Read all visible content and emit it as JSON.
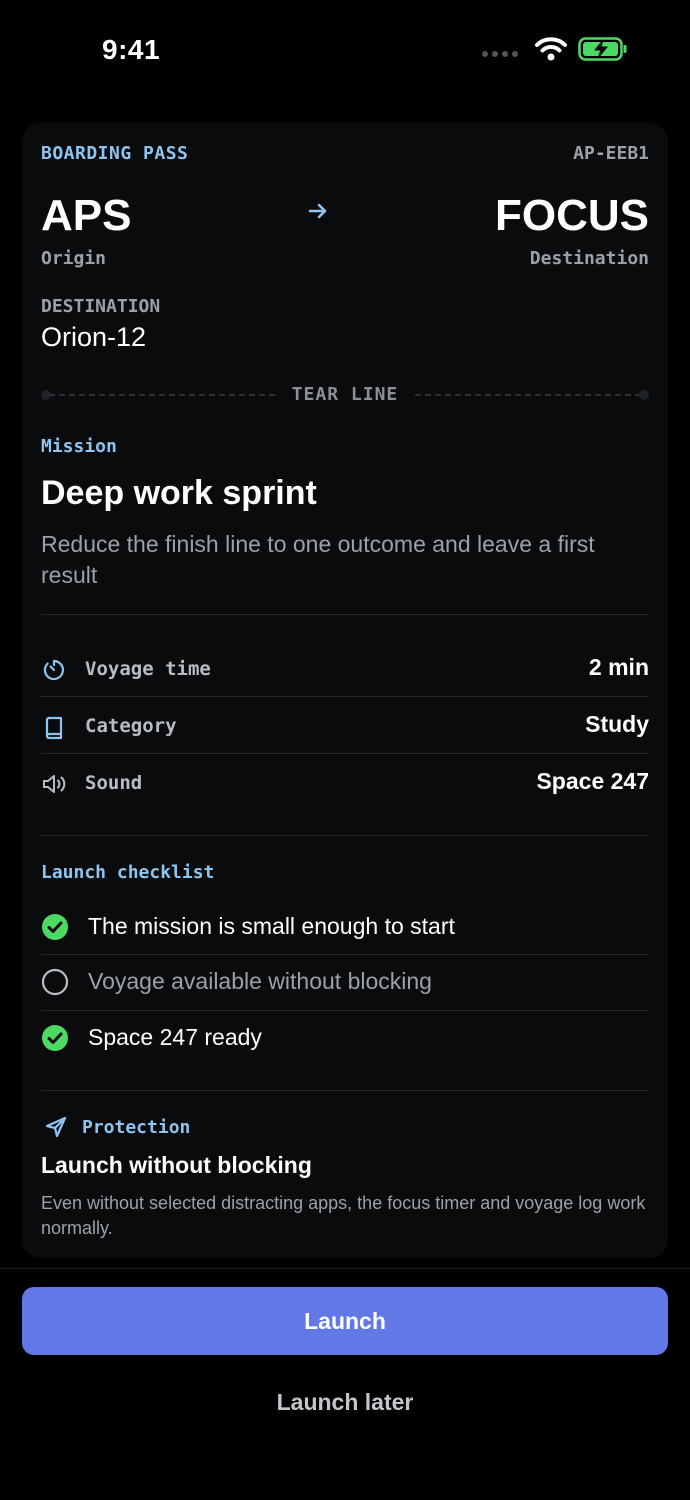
{
  "status_bar": {
    "time": "9:41",
    "icons": [
      "signal-dots-icon",
      "wifi-icon",
      "battery-charging-icon"
    ],
    "battery_color": "#4cd964"
  },
  "boarding_pass": {
    "label": "BOARDING PASS",
    "code": "AP-EEB1",
    "origin_code": "APS",
    "origin_label": "Origin",
    "destination_code": "FOCUS",
    "destination_label": "Destination",
    "route_icon": "arrow-right-icon",
    "destination_heading": "DESTINATION",
    "destination_value": "Orion-12",
    "tear_line": "TEAR LINE"
  },
  "mission": {
    "label": "Mission",
    "title": "Deep work sprint",
    "description": "Reduce the finish line to one outcome and leave a first result"
  },
  "details": [
    {
      "icon": "timer-icon",
      "label": "Voyage time",
      "value": "2 min"
    },
    {
      "icon": "book-icon",
      "label": "Category",
      "value": "Study"
    },
    {
      "icon": "speaker-icon",
      "label": "Sound",
      "value": "Space 247"
    }
  ],
  "checklist": {
    "label": "Launch checklist",
    "items": [
      {
        "text": "The mission is small enough to start",
        "checked": true
      },
      {
        "text": "Voyage available without blocking",
        "checked": false
      },
      {
        "text": "Space 247 ready",
        "checked": true
      }
    ]
  },
  "protection": {
    "icon": "paper-plane-icon",
    "label": "Protection",
    "title": "Launch without blocking",
    "description": "Even without selected distracting apps, the focus timer and voyage log work normally."
  },
  "actions": {
    "launch": "Launch",
    "launch_later": "Launch later"
  },
  "colors": {
    "accent": "#8ec5f0",
    "primary_button": "#6178e6",
    "check_green": "#4cd964",
    "card_bg": "#0a0b0d"
  }
}
